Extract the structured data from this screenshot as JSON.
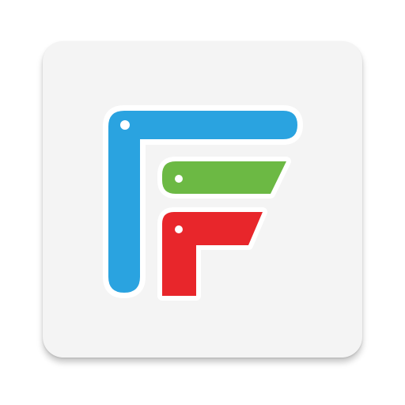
{
  "app_icon": {
    "icon_name": "ff-logo-icon",
    "tile_color": "#f4f4f4",
    "colors": {
      "blue": "#2aa3e0",
      "green": "#6cb944",
      "red": "#e8262b",
      "outline": "#ffffff"
    }
  }
}
